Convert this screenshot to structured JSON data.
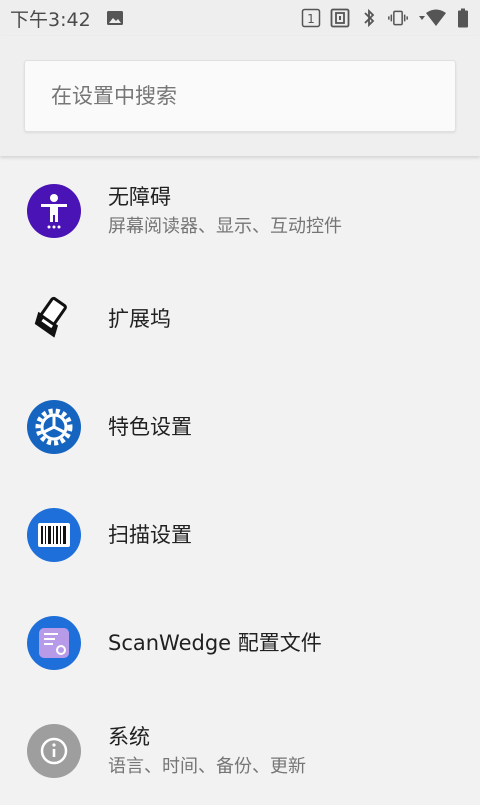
{
  "status_bar": {
    "time": "下午3:42",
    "left_icons": [
      "image-icon"
    ],
    "right_icons": [
      "sim-1-icon",
      "nfc-icon",
      "bluetooth-icon",
      "vibrate-icon",
      "wifi-icon",
      "battery-icon"
    ]
  },
  "search": {
    "placeholder": "在设置中搜索"
  },
  "settings": [
    {
      "title": "无障碍",
      "subtitle": "屏幕阅读器、显示、互动控件",
      "icon": "accessibility-icon",
      "color": "#4a13b5"
    },
    {
      "title": "扩展坞",
      "subtitle": "",
      "icon": "dock-icon",
      "color": "#000000"
    },
    {
      "title": "特色设置",
      "subtitle": "",
      "icon": "feature-settings-icon",
      "color": "#1565c0"
    },
    {
      "title": "扫描设置",
      "subtitle": "",
      "icon": "barcode-scanner-icon",
      "color": "#1e6fd9"
    },
    {
      "title": "ScanWedge 配置文件",
      "subtitle": "",
      "icon": "scanwedge-icon",
      "color": "#1e6fd9"
    },
    {
      "title": "系统",
      "subtitle": "语言、时间、备份、更新",
      "icon": "info-icon",
      "color": "#9e9e9e"
    }
  ],
  "colors": {
    "background": "#f2f2f2",
    "status_bar": "#eeeeee",
    "title_text": "#212121",
    "subtitle_text": "#757575"
  }
}
